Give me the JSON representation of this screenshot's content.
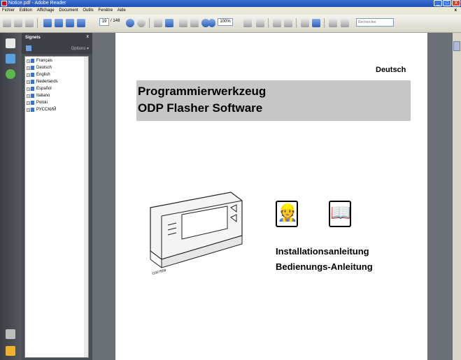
{
  "window": {
    "title": "Notice.pdf - Adobe Reader",
    "min": "_",
    "max": "□",
    "close": "X"
  },
  "menu": [
    "Fichier",
    "Edition",
    "Affichage",
    "Document",
    "Outils",
    "Fenêtre",
    "Aide"
  ],
  "menu_close": "x",
  "toolbar": {
    "page_current": "19",
    "page_total": "/ 148",
    "zoom": "100%",
    "search_placeholder": "Rechercher"
  },
  "bookmarks": {
    "title": "Signets",
    "close": "x",
    "options": "Options ▾",
    "items": [
      "Français",
      "Deutsch",
      "English",
      "Nederlands",
      "Español",
      "Italiano",
      "Polski",
      "РУССКИЙ"
    ]
  },
  "document": {
    "language": "Deutsch",
    "title_line1": "Programmierwerkzeug",
    "title_line2": "ODP Flasher Software",
    "caption1": "Installationsanleitung",
    "caption2": "Bedienungs-Anleitung",
    "device_code": "C007858"
  }
}
